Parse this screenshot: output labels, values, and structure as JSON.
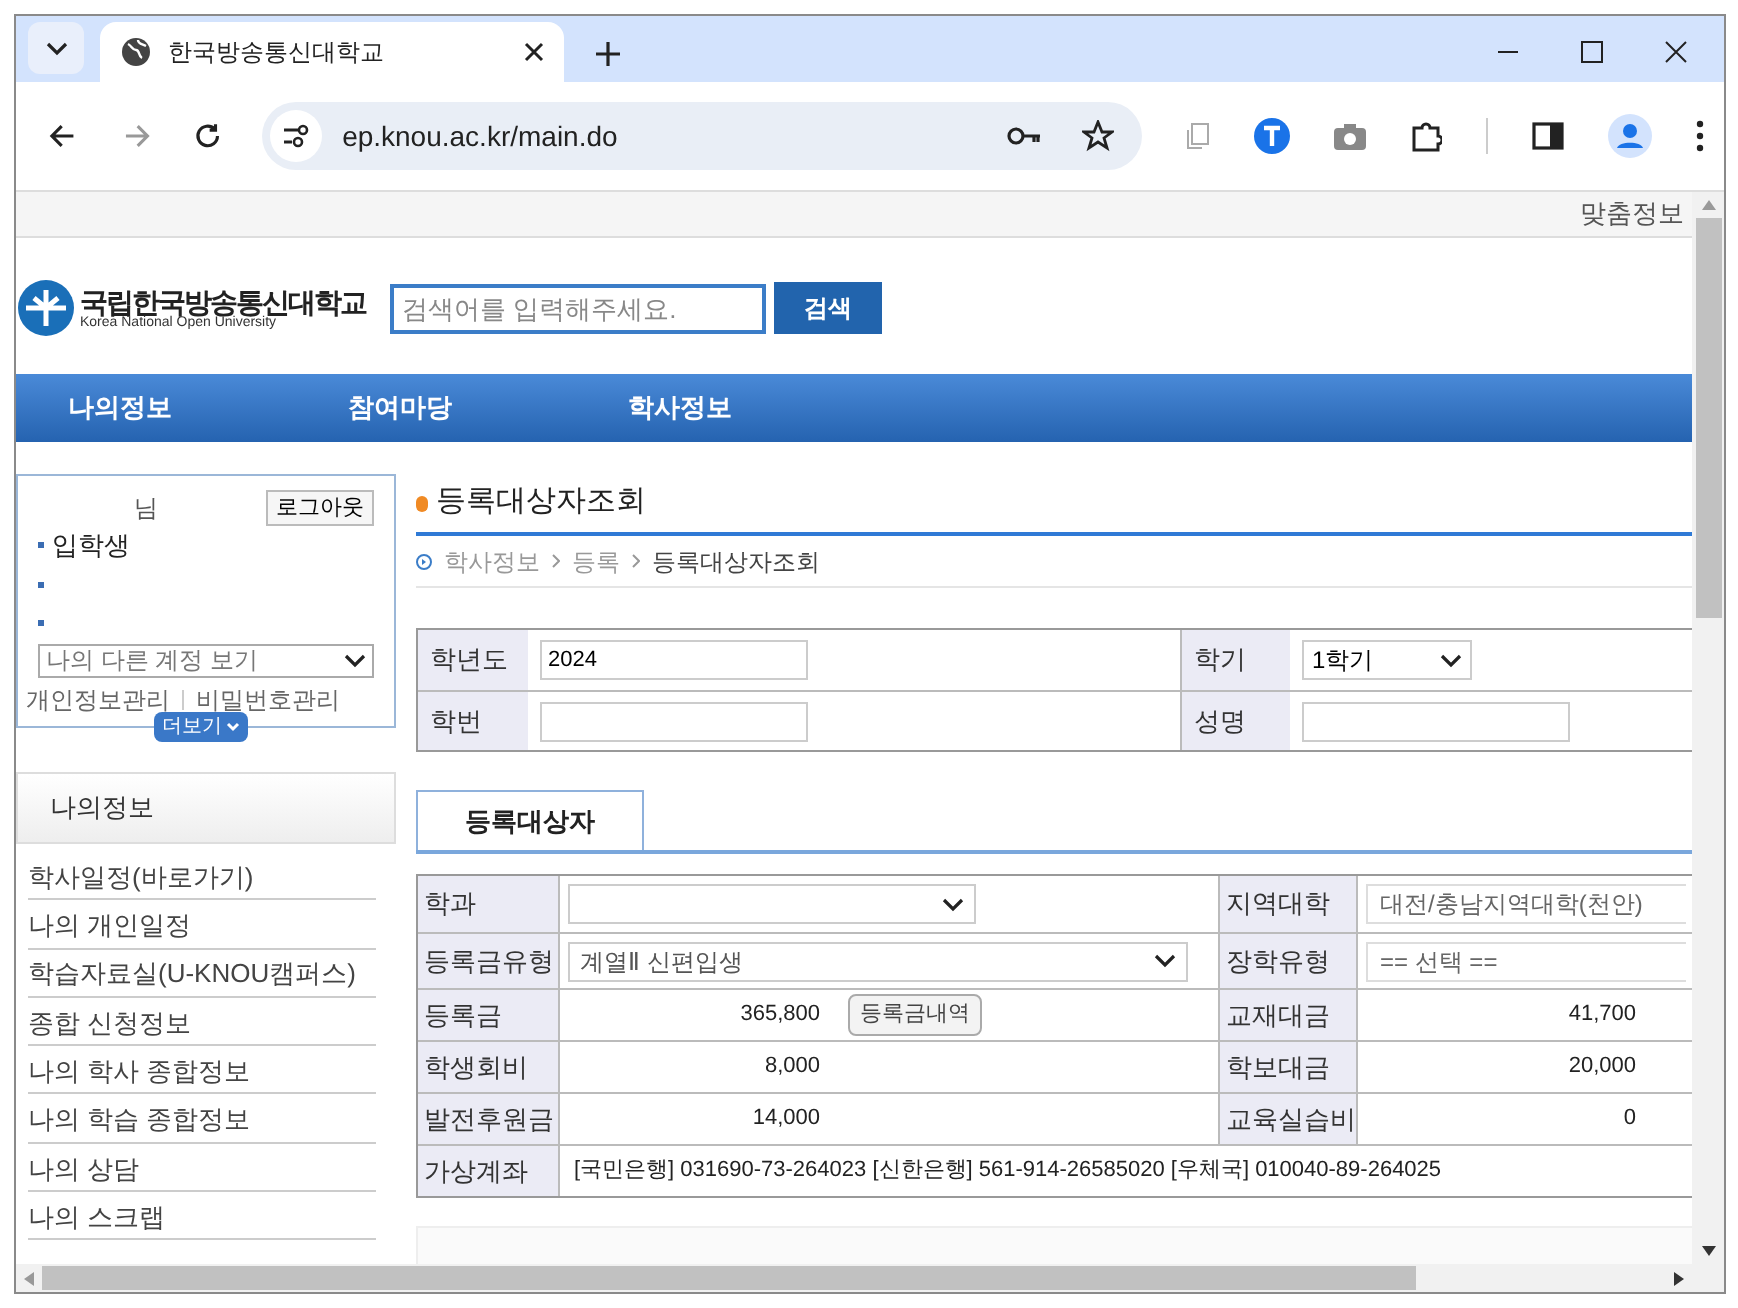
{
  "browser": {
    "tab_title": "한국방송통신대학교",
    "url": "ep.knou.ac.kr/main.do"
  },
  "top_link": "맞춤정보",
  "logo": {
    "korean": "국립한국방송통신대학교",
    "english": "Korea National Open University"
  },
  "search": {
    "placeholder": "검색어를 입력해주세요.",
    "button": "검색"
  },
  "nav": [
    "나의정보",
    "참여마당",
    "학사정보"
  ],
  "user_box": {
    "suffix": "님",
    "logout": "로그아웃",
    "status": "입학생",
    "account_select": "나의 다른 계정 보기",
    "links": [
      "개인정보관리",
      "비밀번호관리"
    ],
    "more": "더보기"
  },
  "menu": {
    "title": "나의정보",
    "items": [
      "학사일정(바로가기)",
      "나의 개인일정",
      "학습자료실(U-KNOU캠퍼스)",
      "종합 신청정보",
      "나의 학사 종합정보",
      "나의 학습 종합정보",
      "나의 상담",
      "나의 스크랩"
    ]
  },
  "page_title": "등록대상자조회",
  "breadcrumb": [
    {
      "label": "학사정보",
      "current": false
    },
    {
      "label": "등록",
      "current": false
    },
    {
      "label": "등록대상자조회",
      "current": true
    }
  ],
  "query_form": [
    [
      {
        "label": "학년도",
        "kind": "text",
        "value": "2024"
      },
      {
        "label": "학기",
        "kind": "select",
        "value": "1학기"
      }
    ],
    [
      {
        "label": "학번",
        "kind": "text"
      },
      {
        "label": "성명",
        "kind": "text"
      }
    ]
  ],
  "tabs": [
    {
      "label": "등록대상자",
      "selected": true
    }
  ],
  "detail": [
    [
      {
        "label": "학과",
        "kind": "select"
      },
      {
        "label": "지역대학",
        "kind": "box",
        "value": "대전/충남지역대학(천안)"
      }
    ],
    [
      {
        "label": "등록금유형",
        "kind": "select",
        "value": "계열Ⅱ 신편입생"
      },
      {
        "label": "장학유형",
        "kind": "box",
        "value": "== 선택 =="
      }
    ],
    [
      {
        "label": "등록금",
        "kind": "amount",
        "value": "365,800",
        "button": "등록금내역"
      },
      {
        "label": "교재대금",
        "kind": "amount",
        "value": "41,700"
      }
    ],
    [
      {
        "label": "학생회비",
        "kind": "amount",
        "value": "8,000"
      },
      {
        "label": "학보대금",
        "kind": "amount",
        "value": "20,000"
      }
    ],
    [
      {
        "label": "발전후원금",
        "kind": "amount",
        "value": "14,000"
      },
      {
        "label": "교육실습비",
        "kind": "amount",
        "value": "0"
      }
    ],
    [
      {
        "label": "가상계좌",
        "kind": "wide",
        "value": "[국민은행] 031690-73-264023 [신한은행] 561-914-26585020 [우체국] 010040-89-264025"
      }
    ]
  ]
}
